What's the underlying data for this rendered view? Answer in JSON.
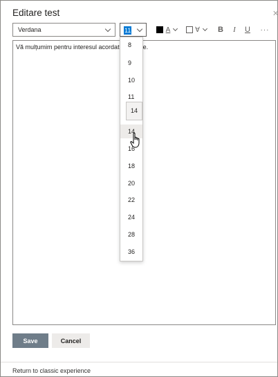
{
  "panel": {
    "title": "Editare test",
    "close_icon": "close-icon"
  },
  "toolbar": {
    "font_family": "Verdana",
    "font_size": "11",
    "font_color": "#000000",
    "font_color_label": "A",
    "highlight_label": "∀",
    "bold_label": "B",
    "italic_label": "I",
    "underline_label": "U",
    "more_label": "···"
  },
  "editor": {
    "text": "Vă mulțumim pentru interesul acordat conducte."
  },
  "size_dropdown": {
    "options": [
      "8",
      "9",
      "10",
      "11",
      "14",
      "16",
      "18",
      "20",
      "22",
      "24",
      "28",
      "36"
    ],
    "hovered": "14",
    "tooltip": "14"
  },
  "footer": {
    "save_label": "Save",
    "cancel_label": "Cancel",
    "classic_link": "Return to classic experience"
  }
}
